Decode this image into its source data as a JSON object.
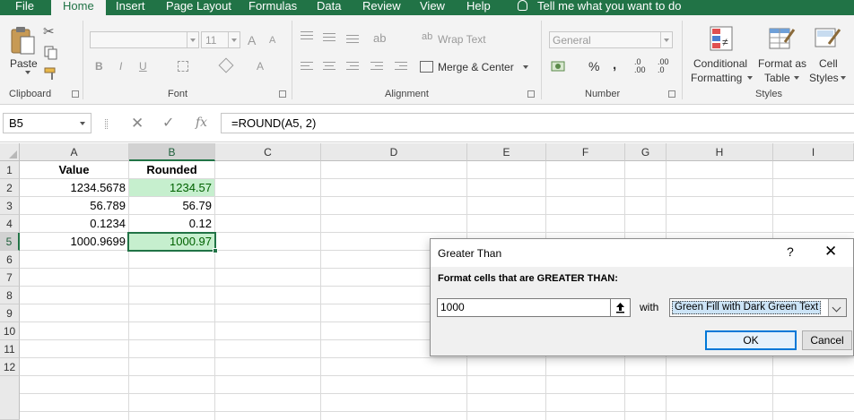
{
  "menu": {
    "tabs": [
      "File",
      "Home",
      "Insert",
      "Page Layout",
      "Formulas",
      "Data",
      "Review",
      "View",
      "Help"
    ],
    "active_tab": "Home",
    "tell_me": "Tell me what you want to do"
  },
  "ribbon": {
    "clipboard": {
      "paste_label": "Paste",
      "group_label": "Clipboard"
    },
    "font": {
      "font_name": "",
      "font_size": "11",
      "bold": "B",
      "italic": "I",
      "underline": "U",
      "grow": "A",
      "shrink": "A",
      "group_label": "Font"
    },
    "alignment": {
      "wrap_text": "Wrap Text",
      "merge_center": "Merge & Center",
      "group_label": "Alignment"
    },
    "number": {
      "format": "General",
      "percent": "%",
      "comma": ",",
      "inc_decimal_top": ".0",
      "inc_decimal_bottom": ".00",
      "dec_decimal_top": ".00",
      "dec_decimal_bottom": ".0",
      "group_label": "Number"
    },
    "styles": {
      "conditional_formatting_line1": "Conditional",
      "conditional_formatting_line2": "Formatting",
      "format_as_table_line1": "Format as",
      "format_as_table_line2": "Table",
      "cell_styles_line1": "Cell",
      "cell_styles_line2": "Styles",
      "group_label": "Styles"
    }
  },
  "formula_bar": {
    "name_box": "B5",
    "fx": "fx",
    "formula": "=ROUND(A5, 2)"
  },
  "sheet": {
    "columns": [
      "A",
      "B",
      "C",
      "D",
      "E",
      "F",
      "G",
      "H",
      "I"
    ],
    "rows": [
      "1",
      "2",
      "3",
      "4",
      "5",
      "6",
      "7",
      "8",
      "9",
      "10",
      "11",
      "12"
    ],
    "selected_cell": "B5",
    "headers": {
      "A1": "Value",
      "B1": "Rounded"
    },
    "values": [
      {
        "a": "1234.5678",
        "b": "1234.57",
        "highlight": true
      },
      {
        "a": "56.789",
        "b": "56.79",
        "highlight": false
      },
      {
        "a": "0.1234",
        "b": "0.12",
        "highlight": false
      },
      {
        "a": "1000.9699",
        "b": "1000.97",
        "highlight": true
      }
    ]
  },
  "dialog": {
    "title": "Greater Than",
    "help": "?",
    "close": "✕",
    "prompt": "Format cells that are GREATER THAN:",
    "threshold_value": "1000",
    "with_label": "with",
    "format_option": "Green Fill with Dark Green Text",
    "ok_label": "OK",
    "cancel_label": "Cancel"
  },
  "colors": {
    "accent": "#217346",
    "cf_fill": "#c6efce",
    "cf_text": "#006100",
    "dialog_focus": "#0078d7"
  }
}
